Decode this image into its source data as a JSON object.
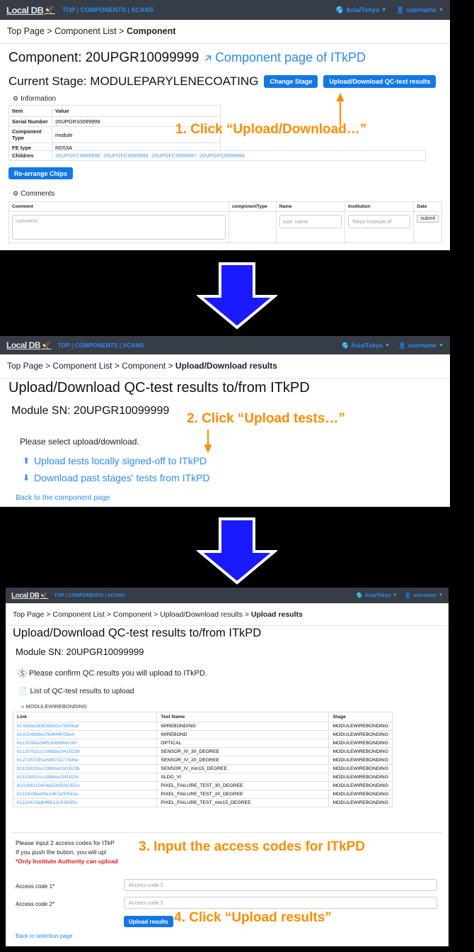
{
  "navbar": {
    "logo": "Local DB",
    "links": [
      "TOP",
      "COMPONENTS",
      "SCANS"
    ],
    "separator": "|",
    "timezone": "Asia/Tokyo",
    "user": "username",
    "globe_icon": "globe-icon",
    "user_icon": "user-icon"
  },
  "panel1": {
    "breadcrumb_parts": [
      "Top Page",
      "Component List"
    ],
    "breadcrumb_current": "Component",
    "breadcrumb_sep": ">",
    "title_label": "Component:",
    "serial": "20UPGR10099999",
    "itkpd_link": "Component page of ITkPD",
    "external_icon": "external-link-icon",
    "stage_label": "Current Stage:",
    "stage_value": "MODULEPARYLENECOATING",
    "btn_change_stage": "Change Stage",
    "btn_upload_download": "Upload/Download QC-test results",
    "information_title": "Information",
    "gear_icon": "gear-icon",
    "info_headers": [
      "Item",
      "Value"
    ],
    "info_rows": [
      {
        "item": "Serial Number",
        "value": "20UPGR10099999"
      },
      {
        "item": "Component Type",
        "value": "module"
      },
      {
        "item": "FE type",
        "value": "RD53A"
      }
    ],
    "children_label": "Children",
    "children": [
      "20UPGFC9999995",
      "20UPGFC9999996",
      "20UPGFC9999997",
      "20UPGFC9999998"
    ],
    "btn_rearrange": "Re-arrange Chips",
    "comments_title": "Comments",
    "comment_headers": [
      "Comment",
      "componentType",
      "Name",
      "Institution",
      "Date"
    ],
    "comment_placeholder": "comment",
    "name_value": "user name",
    "institution_value": "Tokyo Institute of",
    "submit_label": "submit"
  },
  "panel2": {
    "breadcrumb_parts": [
      "Top Page",
      "Component List",
      "Component"
    ],
    "breadcrumb_current": "Upload/Download results",
    "title": "Upload/Download QC-test results to/from ITkPD",
    "module_label": "Module SN:",
    "module_sn": "20UPGR10099999",
    "instruction": "Please select upload/download.",
    "upload_link": "Upload tests locally signed-off to ITkPD",
    "download_link": "Download past stages' tests from ITkPD",
    "upload_icon": "upload-icon",
    "download_icon": "download-icon",
    "back_link": "Back to the component page"
  },
  "panel3": {
    "breadcrumb_parts": [
      "Top Page",
      "Component List",
      "Component",
      "Upload/Download results"
    ],
    "breadcrumb_current": "Upload results",
    "title": "Upload/Download QC-test results to/from ITkPD",
    "module_label": "Module SN:",
    "module_sn": "20UPGR10099999",
    "confirm_text": "Please confirm QC results you will upload to ITkPD.",
    "check_icon": "check-circle-icon",
    "list_title": "List of QC-test results to upload",
    "file_icon": "file-icon",
    "group_label": "» MODULEWIREBONDING",
    "headers": [
      "Link",
      "Test Name",
      "Stage"
    ],
    "rows": [
      {
        "link": "613efde160bd9bd2e7b55baf",
        "test": "WIREBONDING",
        "stage": "MODULEWIREBONDING"
      },
      {
        "link": "6143148d6e1ffe9f4ff038e4",
        "test": "WIREBOND",
        "stage": "MODULEWIREBONDING"
      },
      {
        "link": "6112039ac94f52b6bffe6193",
        "test": "OPTICAL",
        "stage": "MODULEWIREBONDING"
      },
      {
        "link": "611207b1ccc38bbac0418239",
        "test": "SENSOR_IV_30_DEGREE",
        "stage": "MODULEWIREBONDING"
      },
      {
        "link": "61272573ff1e5897417740be",
        "test": "SENSOR_IV_20_DEGREE",
        "stage": "MODULEWIREBONDING"
      },
      {
        "link": "61120820ccc38bbac041823b",
        "test": "SENSOR_IV_min15_DEGREE",
        "stage": "MODULEWIREBONDING"
      },
      {
        "link": "61120852ccc38bbac041823c",
        "test": "SLDO_VI",
        "stage": "MODULEWIREBONDING"
      },
      {
        "link": "610cb8112e04e52b9281351c",
        "test": "PIXEL_FAILURE_TEST_30_DEGREE",
        "stage": "MODULEWIREBONDING"
      },
      {
        "link": "6111fe09eef9e1d67e00943a",
        "test": "PIXEL_FAILURE_TEST_20_DEGREE",
        "stage": "MODULEWIREBONDING"
      },
      {
        "link": "61120415e8df6613c5393f0c",
        "test": "PIXEL_FAILURE_TEST_min15_DEGREE",
        "stage": "MODULEWIREBONDING"
      }
    ],
    "note_line1": "Please input 2 access codes for ITkP",
    "note_line2": "If you push the button, you will upl",
    "note_line3": "*Only Institute Authority can upload",
    "access1_label": "Access code 1*",
    "access1_placeholder": "Access code 1",
    "access2_label": "Access code 2*",
    "access2_placeholder": "Access code 2",
    "btn_upload": "Upload results",
    "back_link": "Back to selection page"
  },
  "annotations": {
    "step1": "1. Click “Upload/Download…”",
    "step2": "2. Click “Upload tests…”",
    "step3": "3. Input the access codes for ITkPD",
    "step4": "4. Click “Upload results”",
    "accent_color": "#FF8C00",
    "arrow_color": "#1a1aff"
  }
}
